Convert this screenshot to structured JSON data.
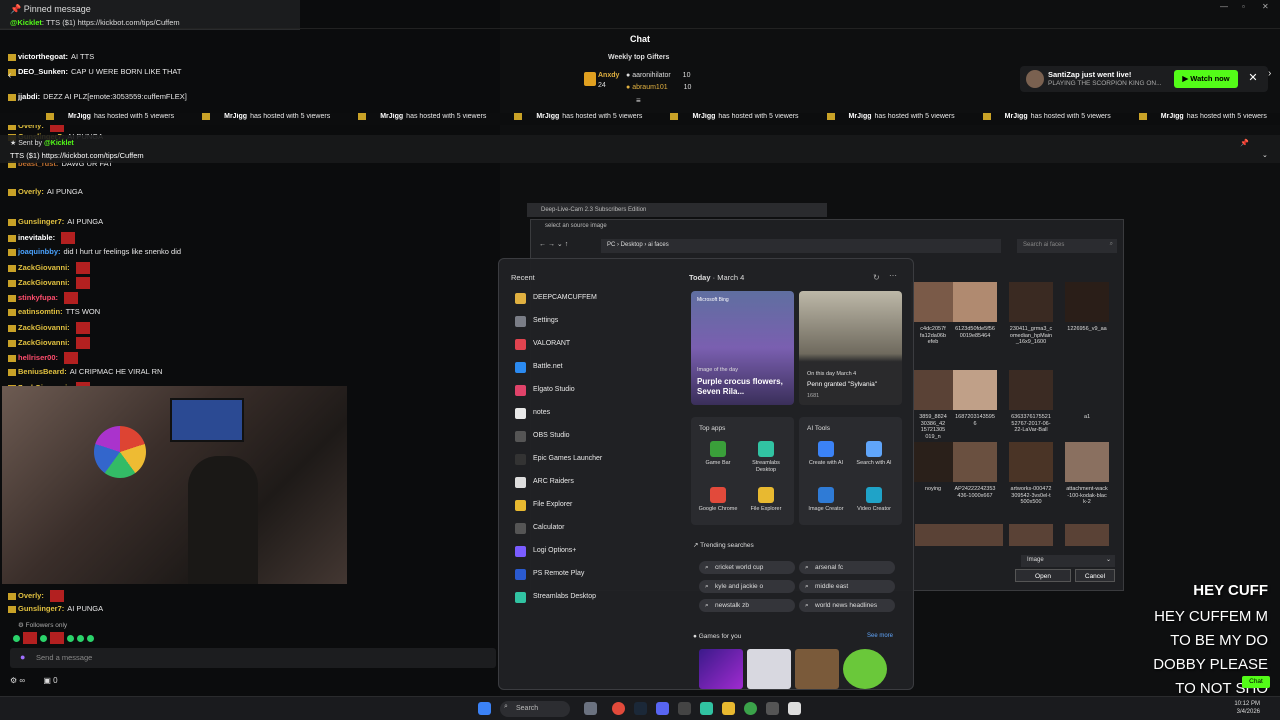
{
  "pinned": {
    "title": "Pinned message",
    "sender": "@Kicklet",
    "text": ": TTS ($1) https://kickbot.com/tips/Cuffem"
  },
  "chat_title": "Chat",
  "gifters": {
    "heading": "Weekly top Gifters",
    "top": {
      "name": "Anxdy",
      "count": "24"
    },
    "list": [
      {
        "name": "aaronihilator",
        "count": "10"
      },
      {
        "name": "abraum101",
        "count": "10"
      }
    ]
  },
  "live_toast": {
    "line1": "SantiZap just went live!",
    "line2": "PLAYING THE SCORPION KING ON...",
    "watch": "Watch now",
    "close": "✕"
  },
  "ticker": {
    "user": "MrJigg",
    "text": "has hosted with 5 viewers"
  },
  "sent_by": {
    "label": "Sent by",
    "user": "@Kicklet",
    "text": "TTS ($1) https://kickbot.com/tips/Cuffem"
  },
  "chat_messages": [
    {
      "user": "victorthegoat:",
      "text": "AI TTS",
      "color": "#ffffff"
    },
    {
      "user": "DEO_Sunken:",
      "text": "CAP U WERE BORN LIKE THAT",
      "color": "#ffffff"
    },
    {
      "user": "jjabdi:",
      "text": "DEZZ AI PLZ[emote:3053559:cuffemFLEX]",
      "color": "#ffffff"
    },
    {
      "user": "Overly:",
      "text": "",
      "color": "#e0c040"
    },
    {
      "user": "Gunslinger7:",
      "text": "AI PUNGA",
      "color": "#e0c040"
    },
    {
      "user": "beast_rust:",
      "text": "DAWG UR FAT",
      "color": "#c07030"
    },
    {
      "user": "Overly:",
      "text": "AI PUNGA",
      "color": "#e0c040"
    },
    {
      "user": "Gunslinger7:",
      "text": "AI PUNGA",
      "color": "#e0c040"
    },
    {
      "user": "inevitable:",
      "text": "",
      "color": "#ffffff"
    },
    {
      "user": "joaquinbby:",
      "text": "did I hurt ur feelings like snenko did",
      "color": "#4aa3ff"
    },
    {
      "user": "ZackGiovanni:",
      "text": "",
      "color": "#e0c040"
    },
    {
      "user": "ZackGiovanni:",
      "text": "",
      "color": "#e0c040"
    },
    {
      "user": "stinkyfupa:",
      "text": "",
      "color": "#ff4d6d"
    },
    {
      "user": "eatinsomtin:",
      "text": "TTS WON",
      "color": "#e0c040"
    },
    {
      "user": "ZackGiovanni:",
      "text": "",
      "color": "#e0c040"
    },
    {
      "user": "ZackGiovanni:",
      "text": "",
      "color": "#e0c040"
    },
    {
      "user": "hellriser00:",
      "text": "",
      "color": "#ff4d6d"
    },
    {
      "user": "BeniusBeard:",
      "text": "AI CRIPMAC HE VIRAL RN",
      "color": "#e0c040"
    },
    {
      "user": "ZackGiovanni:",
      "text": "",
      "color": "#e0c040"
    }
  ],
  "chat_bottom": [
    {
      "user": "Overly:",
      "text": "",
      "color": "#e0c040"
    },
    {
      "user": "Gunslinger7:",
      "text": "AI PUNGA",
      "color": "#e0c040"
    }
  ],
  "followers_only": "Followers only",
  "chat_input_placeholder": "Send a message",
  "bottom_count": "0",
  "deep_live_cam": {
    "title": "Deep-Live-Cam 2.3 Subscribers Edition"
  },
  "file_dialog": {
    "title": "select an source image",
    "path": "PC  ›  Desktop  ›  ai faces",
    "search_placeholder": "Search ai faces",
    "files": [
      {
        "name": "c4dc2057f\nfa12da06b\nefeb"
      },
      {
        "name": "6123d50fde5f56\n0019e85464"
      },
      {
        "name": "230411_grma3_c\nomedian_hpMain\n_16x9_1600"
      },
      {
        "name": "1226956_v9_aa"
      },
      {
        "name": "3859_8824\n30386_42\n15721305\n019_n"
      },
      {
        "name": "1687203143595\n6"
      },
      {
        "name": "6363376175521\n52767-2017-06-\n22-LaVar-Ball"
      },
      {
        "name": "a1"
      },
      {
        "name": "noying"
      },
      {
        "name": "AP24222242353\n436-1000x667"
      },
      {
        "name": "artworks-000472\n309542-3vs0el-t\n500x500"
      },
      {
        "name": "attachment-wack\n-100-kodak-blac\nk-2"
      }
    ],
    "file_type": "Image",
    "open_label": "Open",
    "cancel_label": "Cancel"
  },
  "start_menu": {
    "recent_heading": "Recent",
    "recent": [
      {
        "label": "DEEPCAMCUFFEM",
        "color": "#e0b040"
      },
      {
        "label": "Settings",
        "color": "#7a7d86"
      },
      {
        "label": "VALORANT",
        "color": "#e0434f"
      },
      {
        "label": "Battle.net",
        "color": "#2b8af0"
      },
      {
        "label": "Elgato Studio",
        "color": "#e0436a"
      },
      {
        "label": "notes",
        "color": "#e8e8e8"
      },
      {
        "label": "OBS Studio",
        "color": "#555"
      },
      {
        "label": "Epic Games Launcher",
        "color": "#333"
      },
      {
        "label": "ARC Raiders",
        "color": "#ddd"
      },
      {
        "label": "File Explorer",
        "color": "#e8b930"
      },
      {
        "label": "Calculator",
        "color": "#555"
      },
      {
        "label": "Logi Options+",
        "color": "#7a5cff"
      },
      {
        "label": "PS Remote Play",
        "color": "#2a5ad0"
      },
      {
        "label": "Streamlabs Desktop",
        "color": "#31c3a2"
      }
    ],
    "today": "Today",
    "date": "March 4",
    "card1": {
      "brand": "Microsoft Bing",
      "small": "Image of the day",
      "title": "Purple crocus flowers, Seven Rila..."
    },
    "card2": {
      "small": "On this day March 4",
      "title": "Penn granted \"Sylvania\"",
      "year": "1681"
    },
    "top_apps_heading": "Top apps",
    "top_apps": [
      {
        "label": "Game Bar",
        "color": "#3a9f3a"
      },
      {
        "label": "Streamlabs Desktop",
        "color": "#31c3a2"
      },
      {
        "label": "Google Chrome",
        "color": "#e24a3b"
      },
      {
        "label": "File Explorer",
        "color": "#e8b930"
      }
    ],
    "ai_tools_heading": "AI Tools",
    "ai_tools": [
      {
        "label": "Create with AI",
        "color": "#3b82f6"
      },
      {
        "label": "Search with AI",
        "color": "#60a5fa"
      },
      {
        "label": "Image Creator",
        "color": "#2f7bd6"
      },
      {
        "label": "Video Creator",
        "color": "#1fa3c8"
      }
    ],
    "trending_heading": "Trending searches",
    "trending": [
      "cricket world cup",
      "arsenal fc",
      "kyle and jackie o",
      "middle east",
      "newstalk zb",
      "world news headlines"
    ],
    "games_heading": "Games for you",
    "see_more": "See more"
  },
  "taskbar": {
    "search_placeholder": "Search",
    "time": "10:12 PM",
    "date": "3/4/2026"
  },
  "captions": [
    "HEY CUFF",
    "HEY CUFFEM M",
    "TO BE MY DO",
    "DOBBY PLEASE",
    "TO NOT SHO"
  ],
  "chat_pill": "Chat",
  "colors": {
    "kick_green": "#53fc18",
    "accent_blue": "#3b82f6"
  }
}
